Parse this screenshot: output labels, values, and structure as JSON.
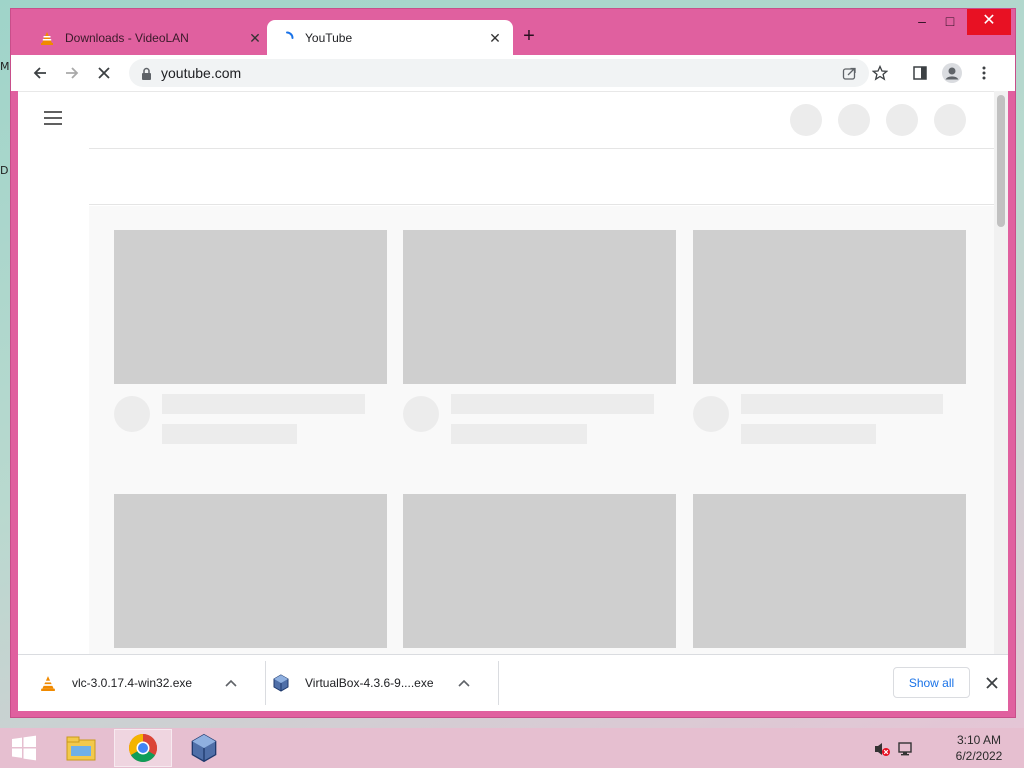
{
  "desktop": {
    "edge_labels": [
      "M",
      "D"
    ]
  },
  "browser": {
    "tabs": [
      {
        "title": "Downloads - VideoLAN",
        "favicon": "vlc-cone-icon",
        "active": false
      },
      {
        "title": "YouTube",
        "favicon": "loading-spinner-icon",
        "active": true
      }
    ],
    "new_tab_label": "+",
    "window_controls": {
      "minimize": "–",
      "maximize": "□",
      "close": "✕"
    },
    "address": {
      "url": "youtube.com"
    },
    "toolbar_icons": [
      "back-icon",
      "forward-icon",
      "stop-loading-icon",
      "lock-icon",
      "share-icon",
      "bookmark-star-icon",
      "side-panel-icon",
      "profile-icon",
      "menu-kebab-icon"
    ],
    "colors": {
      "frame": "#e0609f",
      "accent": "#1a73e8"
    }
  },
  "page": {
    "state": "loading-skeleton",
    "header_placeholders": 4,
    "video_rows": 2,
    "videos_per_row": 3
  },
  "downloads": {
    "items": [
      {
        "filename": "vlc-3.0.17.4-win32.exe",
        "icon": "vlc-cone-icon"
      },
      {
        "filename": "VirtualBox-4.3.6-9....exe",
        "icon": "virtualbox-icon"
      }
    ],
    "show_all_label": "Show all"
  },
  "taskbar": {
    "pinned": [
      "start-icon",
      "file-explorer-icon",
      "chrome-icon",
      "virtualbox-icon"
    ],
    "active": "chrome-icon",
    "clock": {
      "time": "3:10 AM",
      "date": "6/2/2022"
    },
    "tray_icons": [
      "volume-muted-icon",
      "network-icon"
    ]
  }
}
